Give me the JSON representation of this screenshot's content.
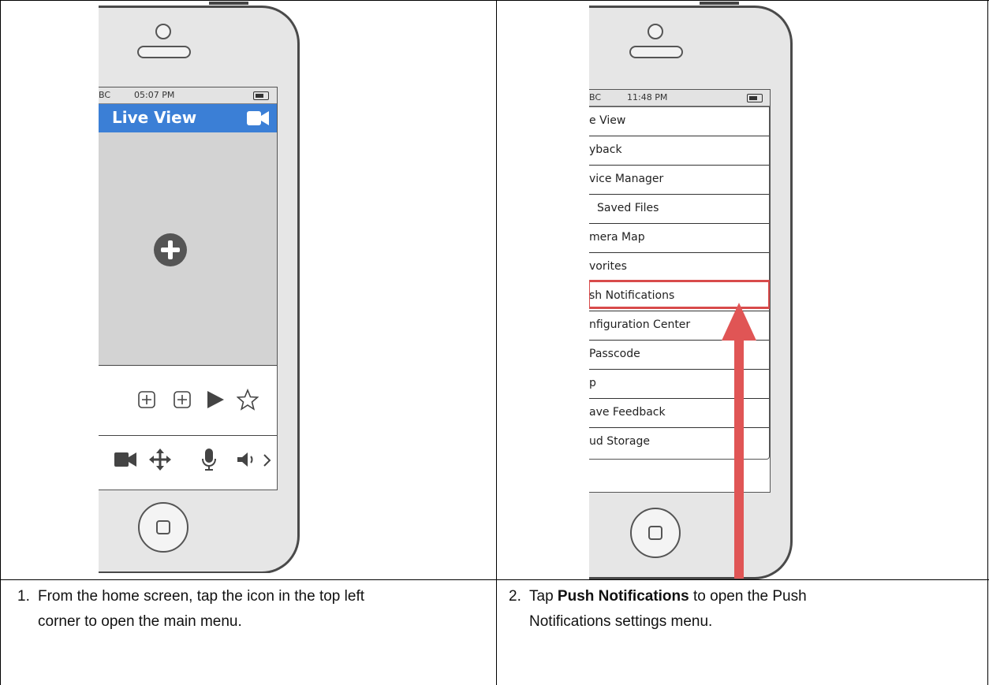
{
  "left_phone": {
    "status": {
      "carrier": "BC",
      "time": "05:07 PM"
    },
    "title": "Live View",
    "icons": [
      "plus-circle-icon",
      "add-box-icon",
      "add-box-icon",
      "play-icon",
      "star-icon",
      "video-camera-icon",
      "move-arrows-icon",
      "microphone-icon",
      "speaker-icon",
      "chevron-right-icon"
    ]
  },
  "right_phone": {
    "status": {
      "carrier": "BC",
      "time": "11:48 PM"
    },
    "menu_items": [
      "e View",
      "yback",
      "vice Manager",
      "Saved Files",
      "mera Map",
      "vorites",
      "sh Notifications",
      "nfiguration Center",
      "Passcode",
      "p",
      "ave Feedback",
      "ud Storage"
    ],
    "highlighted_item": "sh Notifications"
  },
  "captions": {
    "step1": {
      "number": "1.",
      "line1": "From the home screen, tap the icon in the top left",
      "line2": "corner to open the main menu."
    },
    "step2": {
      "number": "2.",
      "prefix": "Tap ",
      "bold": "Push Notifications",
      "suffix": " to open the Push",
      "line2": "Notifications settings menu."
    }
  },
  "colors": {
    "title_bar": "#3b7fd6",
    "highlight": "#d84b4b",
    "arrow": "#e05555"
  }
}
